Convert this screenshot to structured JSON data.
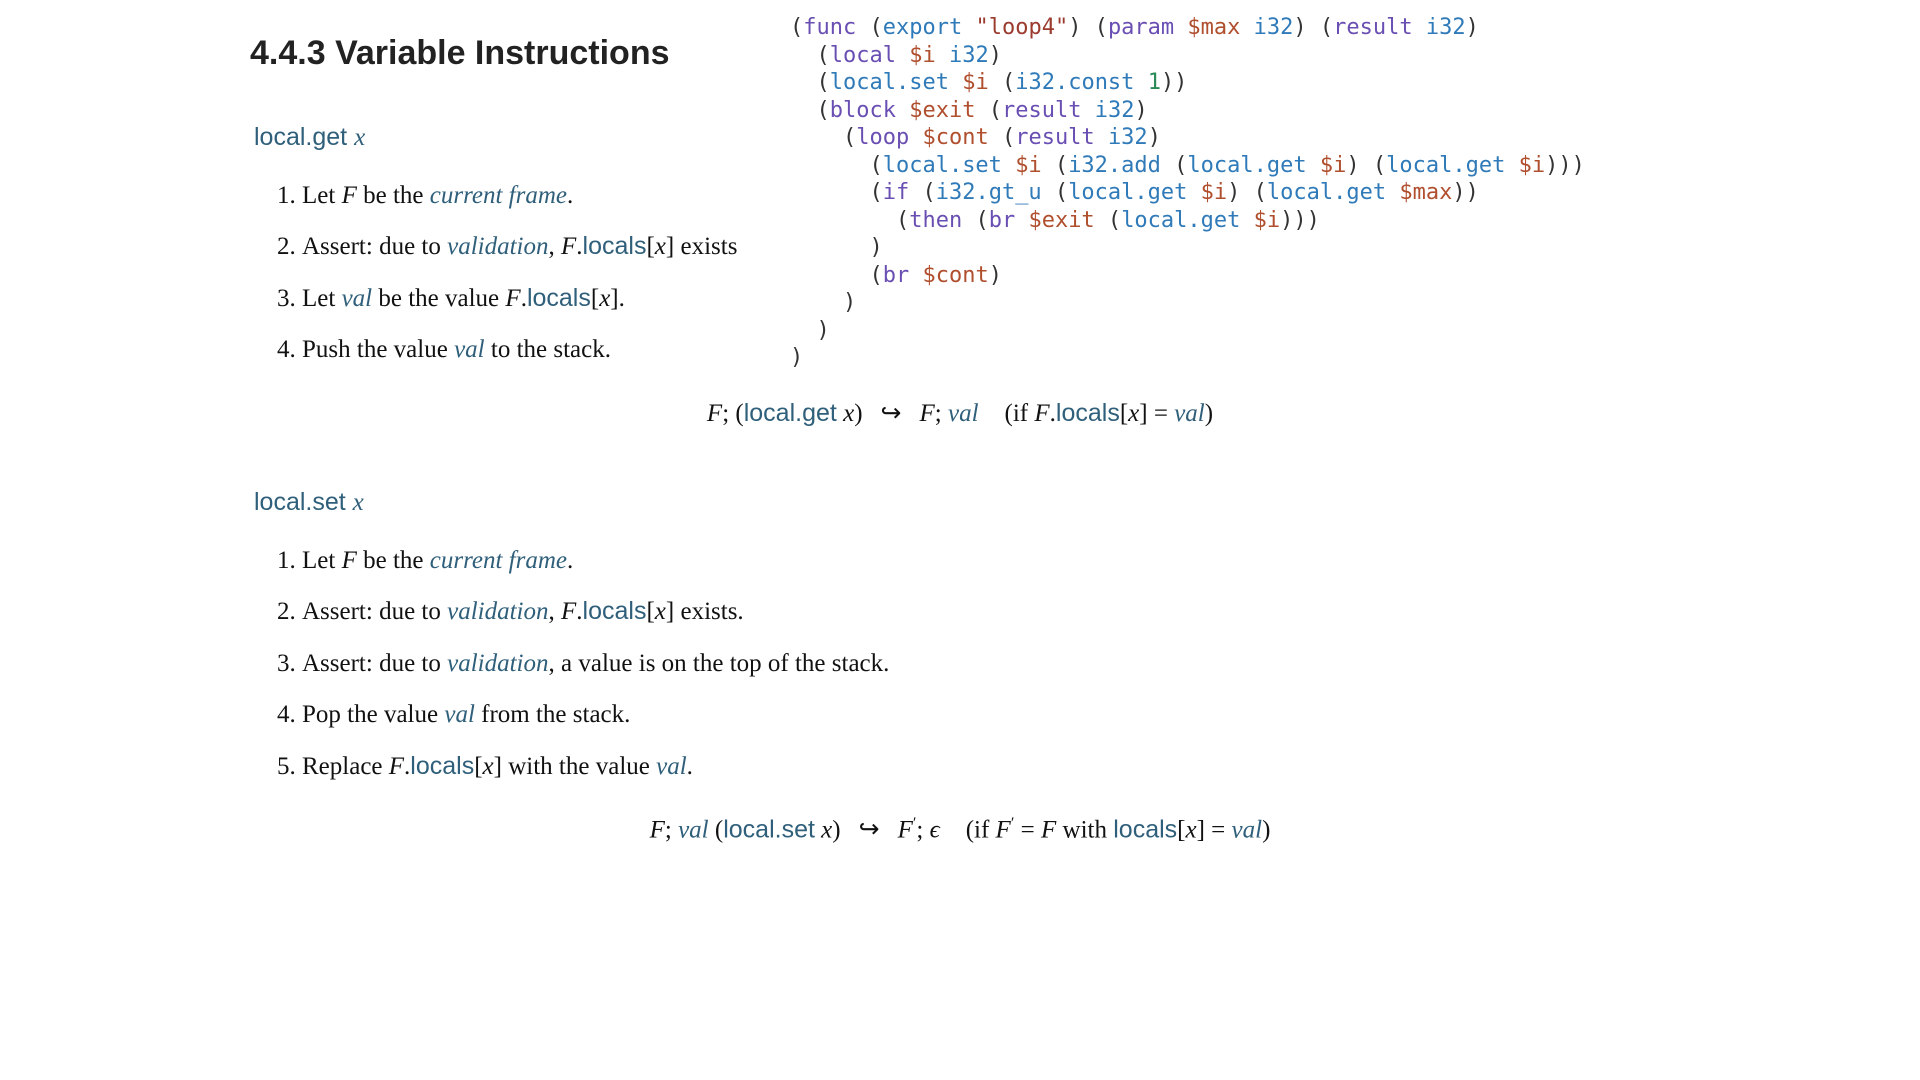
{
  "heading": "4.4.3  Variable Instructions",
  "local_get": {
    "title_kw": "local.get",
    "title_var": "x",
    "steps": {
      "s1a": "Let ",
      "s1F": "F",
      "s1b": " be the ",
      "s1link": "current frame",
      "s1c": ".",
      "s2a": "Assert: due to ",
      "s2link": "validation",
      "s2b": ", ",
      "s2F": "F",
      "s2dot": ".",
      "s2loc": "locals",
      "s2x": "x",
      "s2c": " exists",
      "s3a": "Let ",
      "s3val": "val",
      "s3b": " be the value ",
      "s3F": "F",
      "s3dot": ".",
      "s3loc": "locals",
      "s3x": "x",
      "s3c": ".",
      "s4a": "Push the value ",
      "s4val": "val",
      "s4b": " to the stack."
    },
    "reduction": {
      "F": "F",
      "kw": "local.get",
      "x": "x",
      "arrow": "↪",
      "val": "val",
      "if": "if ",
      "loc": "locals",
      "eq": " = "
    }
  },
  "local_set": {
    "title_kw": "local.set",
    "title_var": "x",
    "steps": {
      "s1a": "Let ",
      "s1F": "F",
      "s1b": " be the ",
      "s1link": "current frame",
      "s1c": ".",
      "s2a": "Assert: due to ",
      "s2link": "validation",
      "s2b": ", ",
      "s2F": "F",
      "s2dot": ".",
      "s2loc": "locals",
      "s2x": "x",
      "s2c": " exists.",
      "s3a": "Assert: due to ",
      "s3link": "validation",
      "s3b": ", a value is on the top of the stack.",
      "s4a": "Pop the value ",
      "s4val": "val",
      "s4b": " from the stack.",
      "s5a": "Replace ",
      "s5F": "F",
      "s5dot": ".",
      "s5loc": "locals",
      "s5x": "x",
      "s5b": " with the value ",
      "s5val": "val",
      "s5c": "."
    },
    "reduction": {
      "F": "F",
      "val": "val",
      "kw": "local.set",
      "x": "x",
      "arrow": "↪",
      "Fp": "F",
      "prime": "′",
      "eps": "ϵ",
      "if": "if ",
      "eq": " = ",
      "with": " with ",
      "loc": "locals"
    }
  },
  "code": {
    "l1a": "(",
    "l1func": "func",
    "l1b": " (",
    "l1export": "export",
    "l1c": " ",
    "l1str": "\"loop4\"",
    "l1d": ") (",
    "l1param": "param",
    "l1e": " ",
    "l1max": "$max",
    "l1f": " ",
    "l1i32a": "i32",
    "l1g": ") (",
    "l1result": "result",
    "l1h": " ",
    "l1i32b": "i32",
    "l1i": ")",
    "l2a": "  (",
    "l2local": "local",
    "l2b": " ",
    "l2i": "$i",
    "l2c": " ",
    "l2i32": "i32",
    "l2d": ")",
    "l3a": "  (",
    "l3set": "local.set",
    "l3b": " ",
    "l3i": "$i",
    "l3c": " (",
    "l3const": "i32.const",
    "l3d": " ",
    "l3one": "1",
    "l3e": "))",
    "l4a": "  (",
    "l4block": "block",
    "l4b": " ",
    "l4exit": "$exit",
    "l4c": " (",
    "l4result": "result",
    "l4d": " ",
    "l4i32": "i32",
    "l4e": ")",
    "l5a": "    (",
    "l5loop": "loop",
    "l5b": " ",
    "l5cont": "$cont",
    "l5c": " (",
    "l5result": "result",
    "l5d": " ",
    "l5i32": "i32",
    "l5e": ")",
    "l6a": "      (",
    "l6set": "local.set",
    "l6b": " ",
    "l6i": "$i",
    "l6c": " (",
    "l6add": "i32.add",
    "l6d": " (",
    "l6get1": "local.get",
    "l6e": " ",
    "l6i2": "$i",
    "l6f": ") (",
    "l6get2": "local.get",
    "l6g": " ",
    "l6i3": "$i",
    "l6h": ")))",
    "l7a": "      (",
    "l7if": "if",
    "l7b": " (",
    "l7gt": "i32.gt_u",
    "l7c": " (",
    "l7get1": "local.get",
    "l7d": " ",
    "l7i": "$i",
    "l7e": ") (",
    "l7get2": "local.get",
    "l7f": " ",
    "l7max": "$max",
    "l7g": "))",
    "l8a": "        (",
    "l8then": "then",
    "l8b": " (",
    "l8br": "br",
    "l8c": " ",
    "l8exit": "$exit",
    "l8d": " (",
    "l8get": "local.get",
    "l8e": " ",
    "l8i": "$i",
    "l8f": ")))",
    "l9": "      )",
    "l10a": "      (",
    "l10br": "br",
    "l10b": " ",
    "l10cont": "$cont",
    "l10c": ")",
    "l11": "    )",
    "l12": "  )",
    "l13": ")"
  }
}
